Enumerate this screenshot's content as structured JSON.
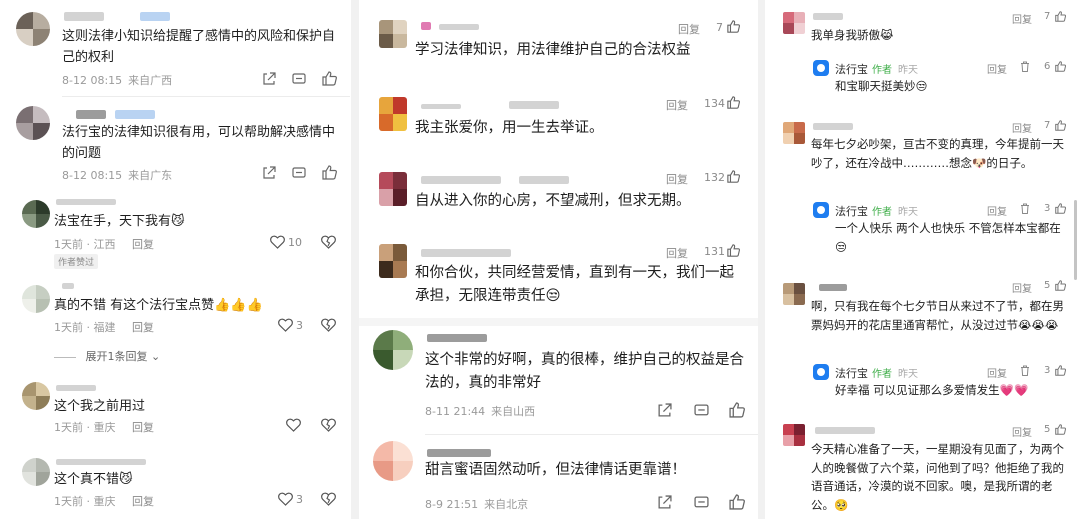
{
  "icons": {
    "share": "share-icon",
    "comment": "comment-icon",
    "like": "thumbs-up-icon",
    "heart": "heart-icon",
    "dislike": "broken-heart-icon",
    "trash": "trash-icon"
  },
  "panel1": {
    "c1": {
      "text": "这则法律小知识给提醒了感情中的风险和保护自己的权利",
      "date": "8-12 08:15",
      "loc": "来自广西"
    },
    "c2": {
      "text": "法行宝的法律知识很有用，可以帮助解决感情中的问题",
      "date": "8-12 08:15",
      "loc": "来自广东"
    },
    "c3": {
      "text": "法宝在手，天下我有",
      "emoji": "😼",
      "time": "1天前 · 江西",
      "reply": "回复",
      "likes": "10",
      "badge": "作者赞过"
    },
    "c4": {
      "text": "真的不错 有这个法行宝点赞",
      "emoji": "👍👍👍",
      "time": "1天前 · 福建",
      "reply": "回复",
      "likes": "3"
    },
    "expand": "展开1条回复",
    "c5": {
      "text": "这个我之前用过",
      "time": "1天前 · 重庆",
      "reply": "回复"
    },
    "c6": {
      "text": "这个真不错",
      "emoji": "😼",
      "time": "1天前 · 重庆",
      "reply": "回复",
      "likes": "3"
    }
  },
  "panel2": {
    "c1": {
      "text": "学习法律知识，用法律维护自己的合法权益",
      "reply": "回复",
      "likes": "7"
    },
    "c2": {
      "text": "我主张爱你，用一生去举证。",
      "reply": "回复",
      "likes": "134"
    },
    "c3": {
      "text": "自从进入你的心房，不望减刑，但求无期。",
      "reply": "回复",
      "likes": "132"
    },
    "c4": {
      "text": "和你合伙，共同经营爱情，直到有一天，我们一起承担，无限连带责任",
      "emoji": "😒",
      "reply": "回复",
      "likes": "131"
    },
    "c5": {
      "text": "这个非常的好啊，真的很棒，维护自己的权益是合法的，真的非常好",
      "date": "8-11 21:44",
      "loc": "来自山西"
    },
    "c6": {
      "text": "甜言蜜语固然动听，但法律情话更靠谱！",
      "date": "8-9 21:51",
      "loc": "来自北京"
    }
  },
  "panel3": {
    "c1": {
      "text": "我单身我骄傲",
      "emoji": "😹",
      "reply": "回复",
      "likes": "7"
    },
    "r1": {
      "name": "法行宝",
      "tag": "作者",
      "time": "昨天",
      "text": "和宝聊天挺美妙",
      "emoji": "😒",
      "reply": "回复",
      "likes": "6"
    },
    "c2": {
      "text": "每年七夕必吵架，亘古不变的真理，今年提前一天吵了，还在冷战中…………想念",
      "emoji": "🐶",
      "text_end": "的日子。",
      "reply": "回复",
      "likes": "7"
    },
    "r2": {
      "name": "法行宝",
      "tag": "作者",
      "time": "昨天",
      "text": "一个人快乐 两个人也快乐 不管怎样本宝都在",
      "emoji": "😒",
      "reply": "回复",
      "likes": "3"
    },
    "c3": {
      "text": "啊，只有我在每个七夕节日从来过不了节，都在男票妈妈开的花店里通宵帮忙，从没过过节",
      "emoji": "😭😭😭",
      "reply": "回复",
      "likes": "5"
    },
    "r3": {
      "name": "法行宝",
      "tag": "作者",
      "time": "昨天",
      "text": "好幸福 可以见证那么多爱情发生",
      "emoji": "💗💗",
      "reply": "回复",
      "likes": "3"
    },
    "c4": {
      "text": "今天精心准备了一天，一星期没有见面了，为两个人的晚餐做了六个菜，问他到了吗？他拒绝了我的语音通话，冷漠的说不回家。噢，是我所谓的老公。",
      "emoji": "🥺",
      "reply": "回复",
      "likes": "5"
    }
  }
}
